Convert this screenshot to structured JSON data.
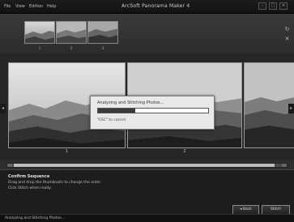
{
  "window": {
    "title": "ArcSoft Panorama Maker 4",
    "menu": [
      "File",
      "View",
      "Edition",
      "Help"
    ],
    "controls": {
      "minimize": "–",
      "maximize": "□",
      "close": "✕"
    }
  },
  "thumbnails": [
    {
      "number": "1"
    },
    {
      "number": "2"
    },
    {
      "number": "3"
    }
  ],
  "side_tools": [
    "rotate-icon",
    "close-icon"
  ],
  "photos": [
    {
      "number": "1"
    },
    {
      "number": "2"
    },
    {
      "number": ""
    }
  ],
  "progress": {
    "title": "Analyzing and Stitching Photos...",
    "percent_label": "34%",
    "percent": 34,
    "note": "\"ESC\" to cancel."
  },
  "info": {
    "heading": "Confirm Sequence",
    "line1": "Drag and drop the thumbnails to change the order.",
    "line2": "Click Stitch when ready."
  },
  "buttons": {
    "back": "◂ Back",
    "stitch": "Stitch"
  },
  "status": {
    "text": "Analyzing and Stitching Photos..."
  },
  "colors": {
    "accent": "#3a3a3a",
    "dialog_bg": "#e9e9e9"
  }
}
